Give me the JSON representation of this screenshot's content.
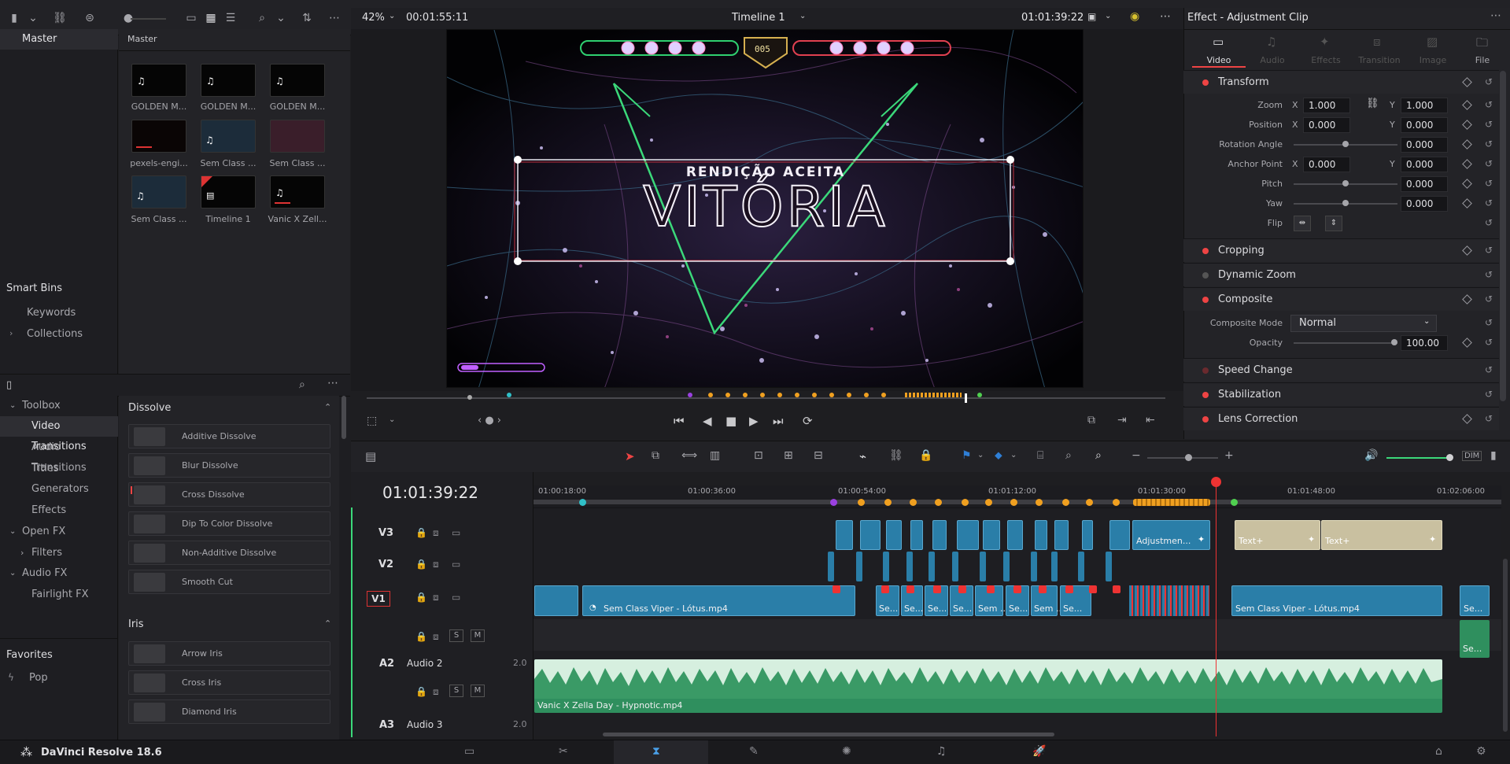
{
  "app": {
    "name": "DaVinci Resolve 18.6"
  },
  "viewer": {
    "zoom": "42%",
    "timecode_left": "00:01:55:11",
    "timeline_name": "Timeline 1",
    "timecode_right": "01:01:39:22",
    "overlay_small": "RENDIÇÃO ACEITA",
    "overlay_big": "VITÓRIA",
    "hud_center": "005"
  },
  "media_pool": {
    "bin_left": "Master",
    "bin_right": "Master",
    "items": [
      {
        "label": "GOLDEN M...",
        "kind": "audio"
      },
      {
        "label": "GOLDEN M...",
        "kind": "audio"
      },
      {
        "label": "GOLDEN M...",
        "kind": "audio"
      },
      {
        "label": "pexels-engi...",
        "kind": "video"
      },
      {
        "label": "Sem Class ...",
        "kind": "video"
      },
      {
        "label": "Sem Class ...",
        "kind": "video"
      },
      {
        "label": "Sem Class ...",
        "kind": "video"
      },
      {
        "label": "Timeline 1",
        "kind": "timeline"
      },
      {
        "label": "Vanic X Zell...",
        "kind": "audio"
      }
    ],
    "smart_bins": "Smart Bins",
    "keywords": "Keywords",
    "collections": "Collections"
  },
  "effects_library": {
    "tree": [
      {
        "label": "Toolbox",
        "level": 0,
        "expanded": true
      },
      {
        "label": "Video Transitions",
        "level": 1,
        "selected": true
      },
      {
        "label": "Audio Transitions",
        "level": 1
      },
      {
        "label": "Titles",
        "level": 1
      },
      {
        "label": "Generators",
        "level": 1
      },
      {
        "label": "Effects",
        "level": 1
      },
      {
        "label": "Open FX",
        "level": 0,
        "expanded": true
      },
      {
        "label": "Filters",
        "level": 1
      },
      {
        "label": "Audio FX",
        "level": 0,
        "expanded": true
      },
      {
        "label": "Fairlight FX",
        "level": 1
      }
    ],
    "favorites": "Favorites",
    "favorite_item": "Pop",
    "dissolve_header": "Dissolve",
    "dissolve_items": [
      "Additive Dissolve",
      "Blur Dissolve",
      "Cross Dissolve",
      "Dip To Color Dissolve",
      "Non-Additive Dissolve",
      "Smooth Cut"
    ],
    "iris_header": "Iris",
    "iris_items": [
      "Arrow Iris",
      "Cross Iris",
      "Diamond Iris"
    ]
  },
  "inspector": {
    "title": "Effect - Adjustment Clip",
    "tabs": [
      "Video",
      "Audio",
      "Effects",
      "Transition",
      "Image",
      "File"
    ],
    "transform": {
      "label": "Transform",
      "zoom_label": "Zoom",
      "zoom_x": "1.000",
      "zoom_y": "1.000",
      "position_label": "Position",
      "position_x": "0.000",
      "position_y": "0.000",
      "rotation_label": "Rotation Angle",
      "rotation": "0.000",
      "anchor_label": "Anchor Point",
      "anchor_x": "0.000",
      "anchor_y": "0.000",
      "pitch_label": "Pitch",
      "pitch": "0.000",
      "yaw_label": "Yaw",
      "yaw": "0.000",
      "flip_label": "Flip"
    },
    "cropping": "Cropping",
    "dynamic_zoom": "Dynamic Zoom",
    "composite": {
      "label": "Composite",
      "mode_label": "Composite Mode",
      "mode": "Normal",
      "opacity_label": "Opacity",
      "opacity": "100.00"
    },
    "speed_change": "Speed Change",
    "stabilization": "Stabilization",
    "lens_correction": "Lens Correction"
  },
  "timeline": {
    "timecode": "01:01:39:22",
    "ruler": [
      "01:00:18:00",
      "01:00:36:00",
      "01:00:54:00",
      "01:01:12:00",
      "01:01:30:00",
      "01:01:48:00",
      "01:02:06:00"
    ],
    "tracks": {
      "v3": "V3",
      "v2": "V2",
      "v1": "V1",
      "a2": "A2",
      "a2_name": "Audio 2",
      "a2_ch": "2.0",
      "a3": "A3",
      "a3_name": "Audio 3",
      "a3_ch": "2.0"
    },
    "clips": {
      "adjustment": "Adjustmen...",
      "text1": "Text+",
      "text2": "Text+",
      "v1_main": "Sem Class Viper - Lótus.mp4",
      "v1_main2": "Sem Class Viper - Lótus.mp4",
      "v1_short": [
        "Se...",
        "Se...",
        "Se...",
        "Se...",
        "Sem ...",
        "Se...",
        "Sem ...",
        "Se..."
      ],
      "v1_end": "Se...",
      "audio_clip": "Vanic X Zella Day - Hypnotic.mp4",
      "audio_end": "Se..."
    },
    "mute_label": "M",
    "solo_label": "S"
  }
}
